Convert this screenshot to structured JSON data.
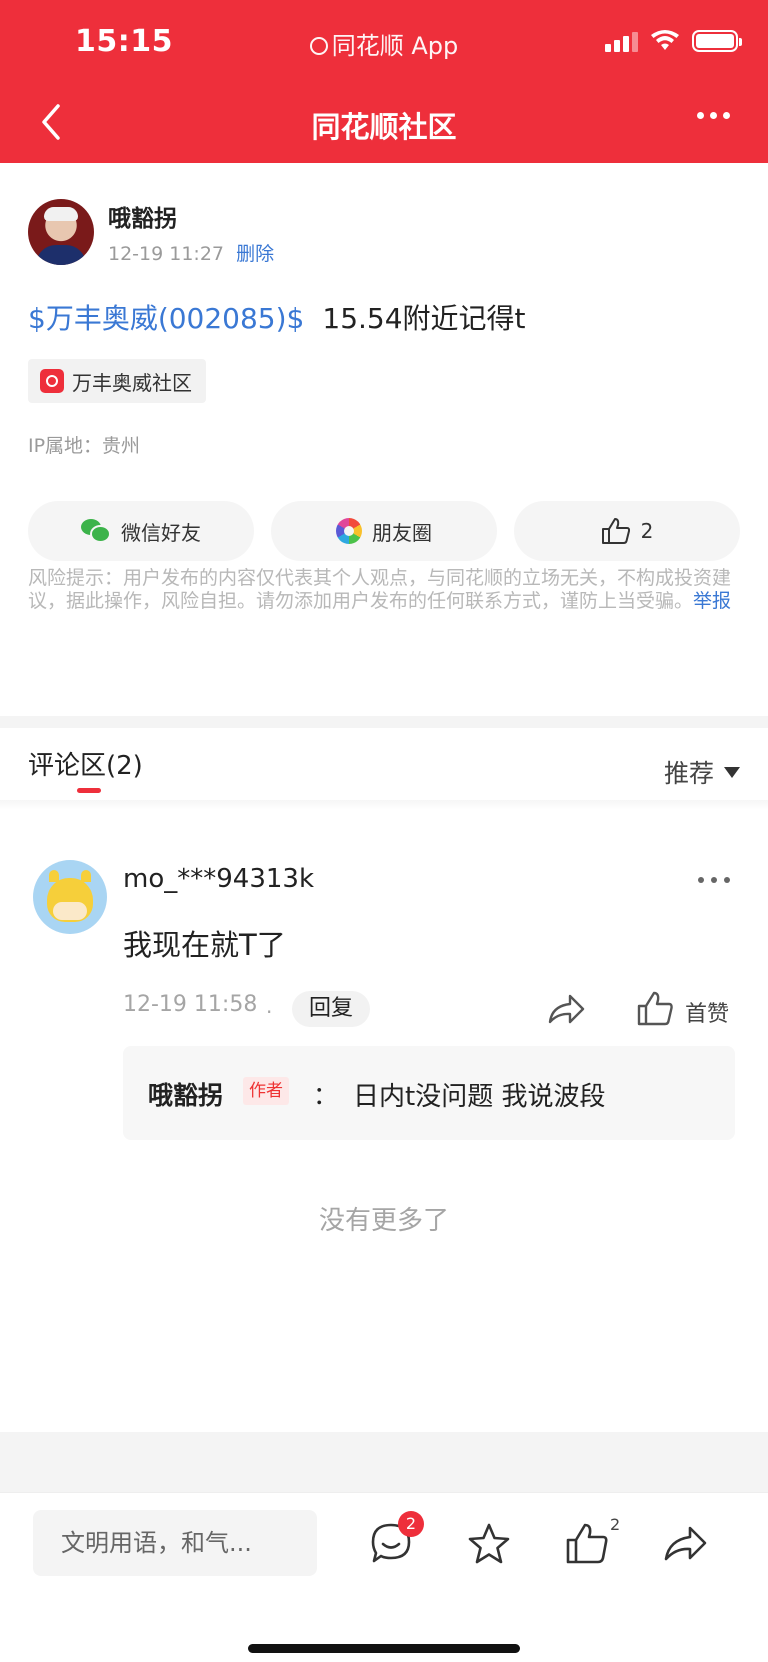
{
  "status_bar": {
    "time": "15:15",
    "app_name": "同花顺 App",
    "icons": [
      "signal-icon",
      "wifi-icon",
      "battery-icon"
    ]
  },
  "nav": {
    "title": "同花顺社区",
    "back_icon": "back-icon",
    "more_icon": "more-icon"
  },
  "post": {
    "author": "哦豁拐",
    "datetime": "12-19 11:27",
    "delete_label": "删除",
    "stock_link": "$万丰奥威(002085)$",
    "text": "15.54附近记得t",
    "community_tag": "万丰奥威社区",
    "ip_location": "IP属地：贵州"
  },
  "share": {
    "wechat_label": "微信好友",
    "moments_label": "朋友圈",
    "like_count": "2"
  },
  "risk_notice": {
    "text": "风险提示：用户发布的内容仅代表其个人观点，与同花顺的立场无关，不构成投资建议，据此操作，风险自担。请勿添加用户发布的任何联系方式，谨防上当受骗。",
    "report_label": "举报"
  },
  "comments": {
    "title": "评论区(2)",
    "sort_label": "推荐",
    "items": [
      {
        "user": "mo_***94313k",
        "text": "我现在就T了",
        "time": "12-19 11:58",
        "separator": "·",
        "reply_label": "回复",
        "like_label": "首赞",
        "replies": [
          {
            "author": "哦豁拐",
            "badge": "作者",
            "colon": "：",
            "text": "日内t没问题 我说波段"
          }
        ]
      }
    ],
    "end_text": "没有更多了"
  },
  "bottom_bar": {
    "input_placeholder": "文明用语，和气...",
    "comment_badge": "2",
    "like_count": "2"
  },
  "colors": {
    "brand_red": "#ee2f3b",
    "link_blue": "#3a78d4"
  }
}
